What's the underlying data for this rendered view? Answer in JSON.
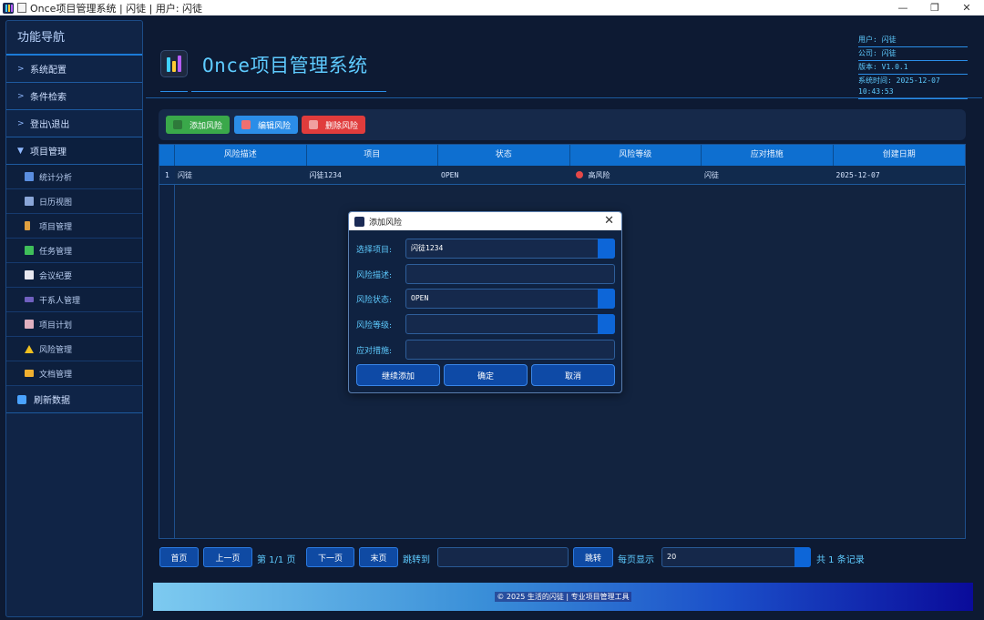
{
  "window": {
    "title": "Once项目管理系统 | 闪徒 | 用户: 闪徒",
    "minimize": "—",
    "restore": "❐",
    "close": "✕"
  },
  "sidebar": {
    "title": "功能导航",
    "groups": [
      {
        "label": "系统配置",
        "arrow": ">"
      },
      {
        "label": "条件检索",
        "arrow": ">"
      },
      {
        "label": "登出\\退出",
        "arrow": ">"
      },
      {
        "label": "项目管理",
        "arrow": "▼"
      }
    ],
    "items": [
      {
        "label": "统计分析",
        "icon": "chart-icon",
        "color": "#5a8ee0"
      },
      {
        "label": "日历视图",
        "icon": "calendar-icon",
        "color": "#8aa6d8"
      },
      {
        "label": "项目管理",
        "icon": "project-icon",
        "color": "#e0a040"
      },
      {
        "label": "任务管理",
        "icon": "task-check-icon",
        "color": "#3fbf5a"
      },
      {
        "label": "会议纪要",
        "icon": "notes-icon",
        "color": "#e8e8f0"
      },
      {
        "label": "干系人管理",
        "icon": "people-icon",
        "color": "#7060c0"
      },
      {
        "label": "项目计划",
        "icon": "clipboard-icon",
        "color": "#e0b0c0"
      },
      {
        "label": "风险管理",
        "icon": "warning-icon",
        "color": "#f0c020"
      },
      {
        "label": "文档管理",
        "icon": "folder-icon",
        "color": "#f0b030"
      }
    ],
    "refresh": "刷新数据"
  },
  "header": {
    "app_title": "Once项目管理系统",
    "user": "用户: 闪徒",
    "company": "公司: 闪徒",
    "version": "版本: V1.0.1",
    "time": "系统时间: 2025-12-07 10:43:53"
  },
  "toolbar": {
    "add": "添加风险",
    "edit": "编辑风险",
    "delete": "删除风险",
    "colors": {
      "add": "#3aa84a",
      "edit": "#2b8de8",
      "delete": "#e03c3c"
    }
  },
  "table": {
    "columns": [
      "风险描述",
      "项目",
      "状态",
      "风险等级",
      "应对措施",
      "创建日期"
    ],
    "rows": [
      {
        "num": "1",
        "desc": "闪徒",
        "project": "闪徒1234",
        "status": "OPEN",
        "level": "高风险",
        "measure": "闪徒",
        "date": "2025-12-07"
      }
    ]
  },
  "pagination": {
    "first": "首页",
    "prev": "上一页",
    "page_info": "第 1/1 页",
    "next": "下一页",
    "last": "末页",
    "jump_label": "跳转到",
    "jump_value": "",
    "jump_btn": "跳转",
    "per_page_label": "每页显示",
    "per_page_value": "20",
    "total": "共 1 条记录"
  },
  "footer": {
    "text": "© 2025 生活的闪徒 | 专业项目管理工具"
  },
  "dialog": {
    "title": "添加风险",
    "fields": [
      {
        "label": "选择项目:",
        "value": "闪徒1234",
        "dropdown": true
      },
      {
        "label": "风险描述:",
        "value": "",
        "dropdown": false
      },
      {
        "label": "风险状态:",
        "value": "OPEN",
        "dropdown": true
      },
      {
        "label": "风险等级:",
        "value": "",
        "dropdown": true
      },
      {
        "label": "应对措施:",
        "value": "",
        "dropdown": false
      }
    ],
    "continue": "继续添加",
    "ok": "确定",
    "cancel": "取消"
  }
}
